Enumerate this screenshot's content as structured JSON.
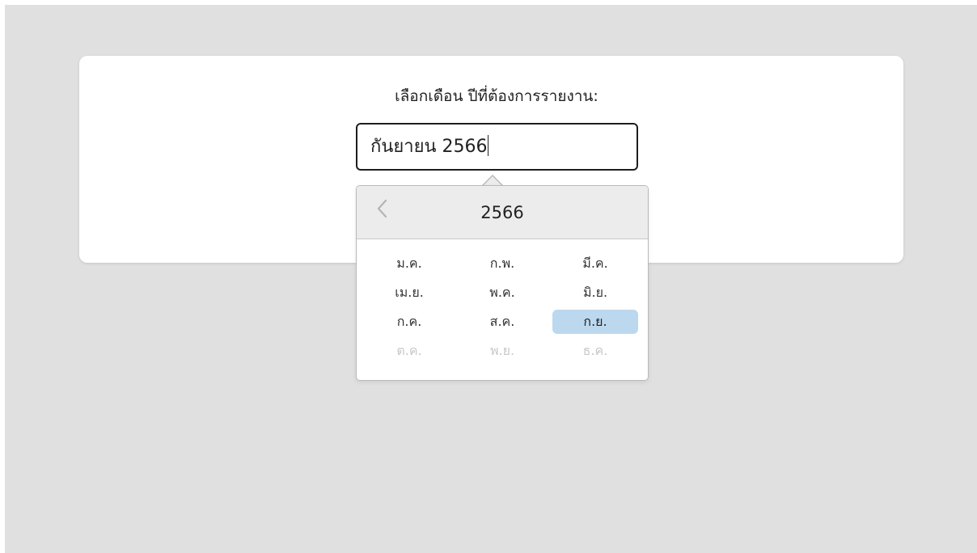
{
  "form": {
    "prompt_label": "เลือกเดือน ปีที่ต้องการรายงาน:",
    "input_value": "กันยายน 2566"
  },
  "picker": {
    "prev_icon": "chevron-left-icon",
    "year": "2566",
    "months": [
      {
        "label": "ม.ค.",
        "state": "enabled"
      },
      {
        "label": "ก.พ.",
        "state": "enabled"
      },
      {
        "label": "มี.ค.",
        "state": "enabled"
      },
      {
        "label": "เม.ย.",
        "state": "enabled"
      },
      {
        "label": "พ.ค.",
        "state": "enabled"
      },
      {
        "label": "มิ.ย.",
        "state": "enabled"
      },
      {
        "label": "ก.ค.",
        "state": "enabled"
      },
      {
        "label": "ส.ค.",
        "state": "enabled"
      },
      {
        "label": "ก.ย.",
        "state": "selected"
      },
      {
        "label": "ต.ค.",
        "state": "disabled"
      },
      {
        "label": "พ.ย.",
        "state": "disabled"
      },
      {
        "label": "ธ.ค.",
        "state": "disabled"
      }
    ],
    "colors": {
      "selected_bg": "#bcd8ef",
      "disabled_text": "#c8c8c8",
      "header_bg": "#ececec"
    }
  }
}
